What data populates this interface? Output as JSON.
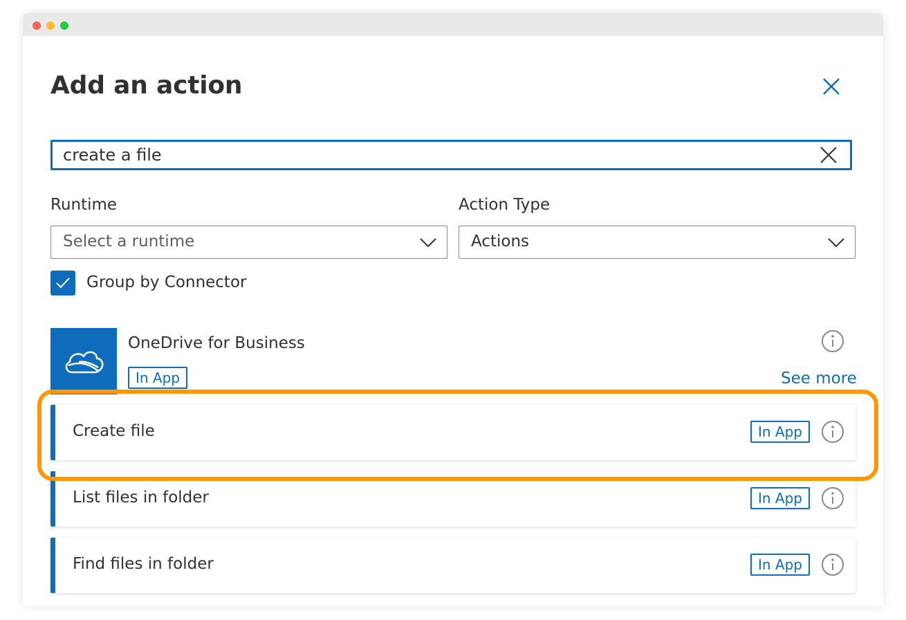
{
  "panel": {
    "title": "Add an action",
    "close_icon": "close-icon"
  },
  "search": {
    "value": "create a file",
    "clear_icon": "close-icon"
  },
  "filters": {
    "runtime": {
      "label": "Runtime",
      "placeholder": "Select a runtime",
      "icon": "chevron-down-icon"
    },
    "action_type": {
      "label": "Action Type",
      "value": "Actions",
      "icon": "chevron-down-icon"
    },
    "group_by_connector": {
      "label": "Group by Connector",
      "checked": true
    }
  },
  "connector": {
    "name": "OneDrive for Business",
    "badge": "In App",
    "logo_icon": "cloud-icon",
    "see_more": "See more",
    "info_icon": "info-icon"
  },
  "actions": [
    {
      "label": "Create file",
      "badge": "In App",
      "highlighted": true
    },
    {
      "label": "List files in folder",
      "badge": "In App",
      "highlighted": false
    },
    {
      "label": "Find files in folder",
      "badge": "In App",
      "highlighted": false
    }
  ],
  "colors": {
    "accent": "#0f6cbd",
    "highlight": "#ff9800",
    "text": "#323130"
  }
}
